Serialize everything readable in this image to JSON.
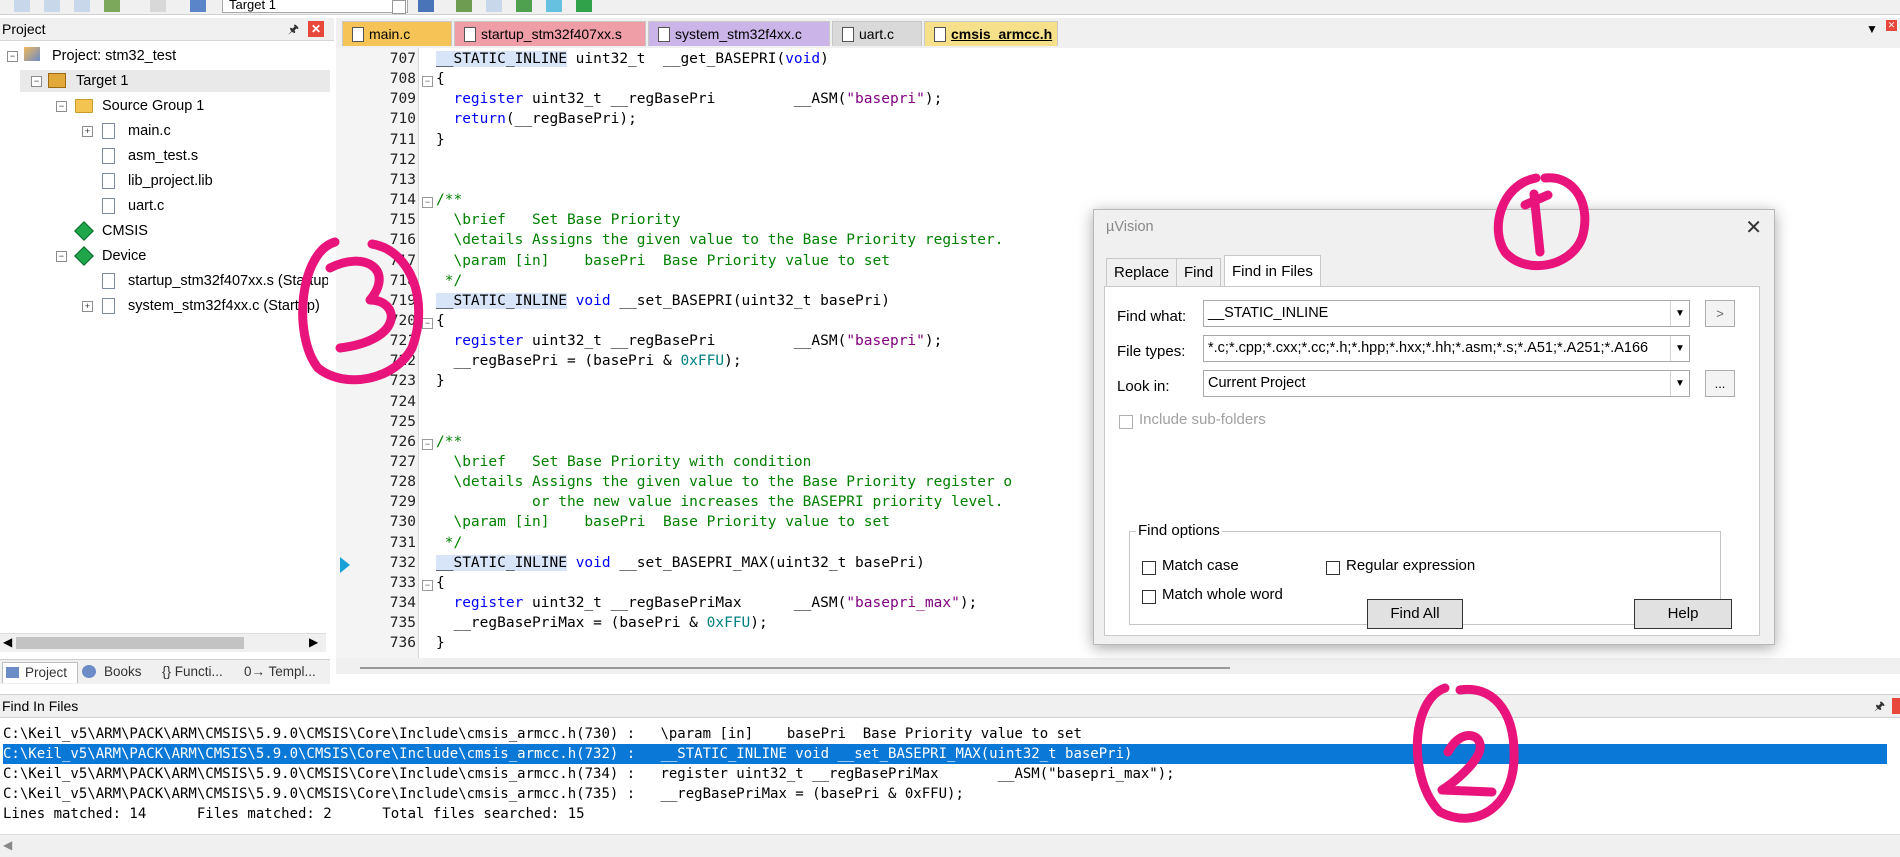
{
  "toolbar": {
    "target": "Target 1"
  },
  "project_panel": {
    "title": "Project",
    "tree": [
      {
        "label": "Project: stm32_test"
      },
      {
        "label": "Target 1"
      },
      {
        "label": "Source Group 1"
      },
      {
        "label": "main.c"
      },
      {
        "label": "asm_test.s"
      },
      {
        "label": "lib_project.lib"
      },
      {
        "label": "uart.c"
      },
      {
        "label": "CMSIS"
      },
      {
        "label": "Device"
      },
      {
        "label": "startup_stm32f407xx.s (Startup)"
      },
      {
        "label": "system_stm32f4xx.c (Startup)"
      }
    ],
    "tabs": [
      {
        "label": "Project"
      },
      {
        "label": "Books"
      },
      {
        "label": "{} Functi..."
      },
      {
        "label": "0→ Templ..."
      }
    ]
  },
  "editor": {
    "tabs": [
      {
        "label": "main.c",
        "color": "#f6c356"
      },
      {
        "label": "startup_stm32f407xx.s",
        "color": "#ef9ea8"
      },
      {
        "label": "system_stm32f4xx.c",
        "color": "#cbb5e8"
      },
      {
        "label": "uart.c",
        "color": "#d9d9d9"
      },
      {
        "label": "cmsis_armcc.h",
        "color": "#f6e08a"
      }
    ],
    "line_numbers": [
      "707",
      "708",
      "709",
      "710",
      "711",
      "712",
      "713",
      "714",
      "715",
      "716",
      "717",
      "718",
      "719",
      "720",
      "721",
      "722",
      "723",
      "724",
      "725",
      "726",
      "727",
      "728",
      "729",
      "730",
      "731",
      "732",
      "733",
      "734",
      "735",
      "736"
    ]
  },
  "dialog": {
    "title": "µVision",
    "tabs": [
      {
        "label": "Replace"
      },
      {
        "label": "Find"
      },
      {
        "label": "Find in Files"
      }
    ],
    "find_what_label": "Find what:",
    "find_what_value": "__STATIC_INLINE",
    "file_types_label": "File types:",
    "file_types_value": "*.c;*.cpp;*.cxx;*.cc;*.h;*.hpp;*.hxx;*.hh;*.asm;*.s;*.A51;*.A251;*.A166",
    "look_in_label": "Look in:",
    "look_in_value": "Current Project",
    "include_sub": "Include sub-folders",
    "find_options": "Find options",
    "match_case": "Match case",
    "regex": "Regular expression",
    "match_whole": "Match whole word",
    "find_all": "Find All",
    "help": "Help"
  },
  "find_panel": {
    "title": "Find In Files",
    "lines": [
      "C:\\Keil_v5\\ARM\\PACK\\ARM\\CMSIS\\5.9.0\\CMSIS\\Core\\Include\\cmsis_armcc.h(730) :   \\param [in]    basePri  Base Priority value to set",
      "C:\\Keil_v5\\ARM\\PACK\\ARM\\CMSIS\\5.9.0\\CMSIS\\Core\\Include\\cmsis_armcc.h(732) :   __STATIC_INLINE void __set_BASEPRI_MAX(uint32_t basePri)",
      "C:\\Keil_v5\\ARM\\PACK\\ARM\\CMSIS\\5.9.0\\CMSIS\\Core\\Include\\cmsis_armcc.h(734) :   register uint32_t __regBasePriMax       __ASM(\"basepri_max\");",
      "C:\\Keil_v5\\ARM\\PACK\\ARM\\CMSIS\\5.9.0\\CMSIS\\Core\\Include\\cmsis_armcc.h(735) :   __regBasePriMax = (basePri & 0xFFU);",
      "Lines matched: 14      Files matched: 2      Total files searched: 15"
    ]
  },
  "colors": {
    "annotation": "#e8147c",
    "selection": "#0a78d7"
  }
}
